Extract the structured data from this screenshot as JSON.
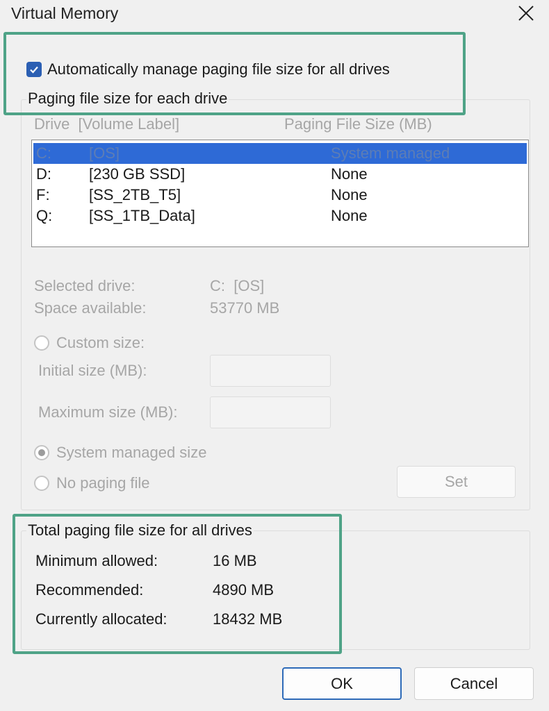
{
  "window": {
    "title": "Virtual Memory"
  },
  "auto_manage": {
    "label": "Automatically manage paging file size for all drives",
    "checked": true
  },
  "paging_group": {
    "legend": "Paging file size for each drive",
    "col_drive": "Drive  [Volume Label]",
    "col_size": "Paging File Size (MB)",
    "rows": [
      {
        "drive": "C:",
        "label": "[OS]",
        "size": "System managed"
      },
      {
        "drive": "D:",
        "label": "[230 GB SSD]",
        "size": "None"
      },
      {
        "drive": "F:",
        "label": "[SS_2TB_T5]",
        "size": "None"
      },
      {
        "drive": "Q:",
        "label": "[SS_1TB_Data]",
        "size": "None"
      }
    ],
    "selected_drive_label": "Selected drive:",
    "selected_drive_value": "C:  [OS]",
    "space_available_label": "Space available:",
    "space_available_value": "53770 MB",
    "custom_size_label": "Custom size:",
    "initial_size_label": "Initial size (MB):",
    "initial_size_value": "",
    "maximum_size_label": "Maximum size (MB):",
    "maximum_size_value": "",
    "system_managed_label": "System managed size",
    "no_paging_label": "No paging file",
    "set_label": "Set"
  },
  "total_group": {
    "legend": "Total paging file size for all drives",
    "minimum_label": "Minimum allowed:",
    "minimum_value": "16 MB",
    "recommended_label": "Recommended:",
    "recommended_value": "4890 MB",
    "allocated_label": "Currently allocated:",
    "allocated_value": "18432 MB"
  },
  "buttons": {
    "ok": "OK",
    "cancel": "Cancel"
  },
  "colors": {
    "accent": "#2b5fb3",
    "highlight": "#4fa387",
    "selection": "#2e6ad6"
  }
}
